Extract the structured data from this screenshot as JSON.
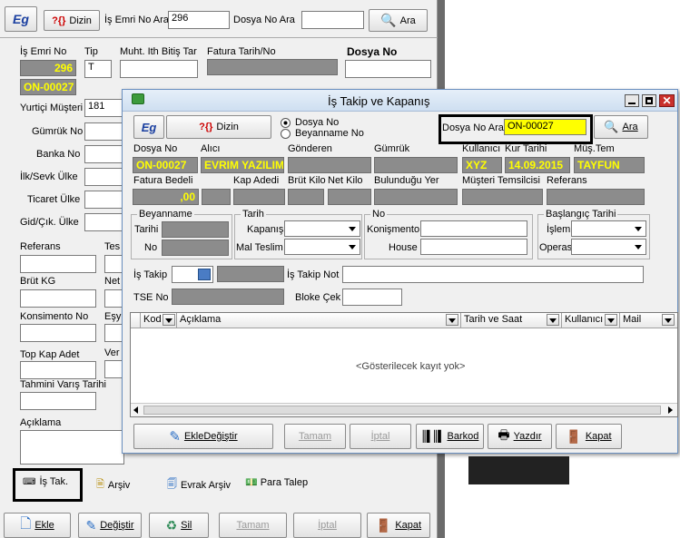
{
  "bg": {
    "logo": "Eg",
    "search_help": "Dizin",
    "is_emri_no_ara_label": "İş Emri No Ara",
    "is_emri_no_ara_value": "296",
    "dosya_no_ara_label": "Dosya No Ara",
    "ara": "Ara",
    "is_emri_no_label": "İş Emri No",
    "is_emri_no_value": "296",
    "tip_label": "Tip",
    "tip_value": "T",
    "muht_label": "Muht. Ith Bitiş Tar",
    "fatura_label": "Fatura Tarih/No",
    "dosya_no_label": "Dosya No",
    "dosya_no_value": "ON-00027",
    "yurtici_musteri": "Yurtiçi Müşteri",
    "yurtici_value": "181",
    "gumruk_no": "Gümrük No",
    "banka_no": "Banka No",
    "ilk_sevk": "İlk/Sevk Ülke",
    "ticaret_ulke": "Ticaret Ülke",
    "gid_cik": "Gid/Çık. Ülke",
    "referans": "Referans",
    "tes": "Tes",
    "brut_kg": "Brüt KG",
    "net": "Net",
    "konsimento_no": "Konsimento No",
    "esy": "Eşy",
    "top_kap_adet": "Top Kap Adet",
    "ver": "Ver",
    "tahmini_varis": "Tahmini Varış Tarihi",
    "aciklama": "Açıklama",
    "is_tak": "İş Tak.",
    "arsiv": "Arşiv",
    "evrak_arsiv": "Evrak Arşiv",
    "para_talep": "Para Talep",
    "ekle": "Ekle",
    "degistir": "Değiştir",
    "sil": "Sil",
    "tamam": "Tamam",
    "iptal": "İptal",
    "kapat": "Kapat"
  },
  "dialog": {
    "title": "İş Takip ve Kapanış",
    "logo": "Eg",
    "dizin": "Dizin",
    "radio_dosya_no": "Dosya No",
    "radio_beyanname_no": "Beyanname No",
    "dosya_no_ara_label": "Dosya No Ara",
    "dosya_no_ara_value": "ON-00027",
    "ara": "Ara",
    "h_dosya_no": "Dosya No",
    "h_alici": "Alıcı",
    "h_gonderen": "Gönderen",
    "h_gumruk": "Gümrük",
    "h_kullanici": "Kullanıcı",
    "h_kur_tarihi": "Kur Tarihi",
    "h_mus_tem": "Müş.Tem",
    "v_dosya_no": "ON-00027",
    "v_alici": "EVRIM YAZILIM",
    "v_kullanici": "XYZ",
    "v_kur_tarihi": "14.09.2015",
    "v_mus_tem": "TAYFUN",
    "h_fatura_bedeli": "Fatura Bedeli",
    "h_kap_adedi": "Kap Adedi",
    "h_brut_kilo": "Brüt Kilo",
    "h_net_kilo": "Net Kilo",
    "h_bulundugu_yer": "Bulunduğu Yer",
    "h_musteri_temsilcisi": "Müşteri Temsilcisi",
    "h_referans": "Referans",
    "v_fatura_bedeli": ",00",
    "g_beyanname": "Beyanname",
    "beyanname_tarihi": "Tarihi",
    "beyanname_no": "No",
    "g_tarih": "Tarih",
    "kapanis": "Kapanış",
    "mal_teslim": "Mal Teslim",
    "g_no": "No",
    "konismento": "Konişmento",
    "house": "House",
    "g_baslangic": "Başlangıç Tarihi",
    "islem": "İşlem",
    "operas": "Operas.",
    "is_takip": "İş Takip",
    "is_takip_not": "İş Takip Not",
    "tse_no": "TSE No",
    "bloke_cek": "Bloke Çek",
    "columns": [
      "Kod",
      "Açıklama",
      "Tarih ve Saat",
      "Kullanıcı",
      "Mail"
    ],
    "empty_text": "<Gösterilecek kayıt yok>",
    "ekle_degistir": "EkleDeğiştir",
    "tamam": "Tamam",
    "iptal": "İptal",
    "barkod": "Barkod",
    "yazdir": "Yazdır",
    "kapat": "Kapat"
  },
  "colors": {
    "highlight_yellow": "#ffff00",
    "readonly_gray": "#8c8c8c",
    "title_bar": "#dbe8f5"
  }
}
